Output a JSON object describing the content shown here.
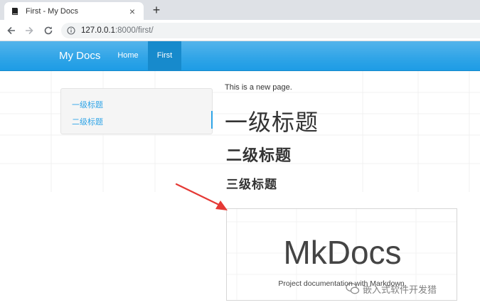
{
  "browser": {
    "tab_title": "First - My Docs",
    "tab_close": "×",
    "new_tab": "+",
    "url_host": "127.0.0.1",
    "url_path": ":8000/first/"
  },
  "site": {
    "brand": "My Docs",
    "nav": [
      {
        "label": "Home",
        "active": false
      },
      {
        "label": "First",
        "active": true
      }
    ]
  },
  "toc": {
    "items": [
      "一级标题",
      "二级标题"
    ]
  },
  "content": {
    "intro": "This is a new page.",
    "h1": "一级标题",
    "h2": "二级标题",
    "h3": "三级标题",
    "screenshot": {
      "title": "MkDocs",
      "subtitle": "Project documentation with Markdown."
    }
  },
  "watermark": {
    "text": "嵌入式软件开发猎"
  },
  "colors": {
    "accent": "#2fa4e7",
    "nav_active": "#178acc",
    "arrow": "#e53935"
  },
  "icons": {
    "tab_favicon": "book-icon",
    "back": "arrow-left-icon",
    "forward": "arrow-right-icon",
    "reload": "reload-icon",
    "site_info": "info-circle-icon",
    "watermark_logo": "wechat-icon"
  }
}
